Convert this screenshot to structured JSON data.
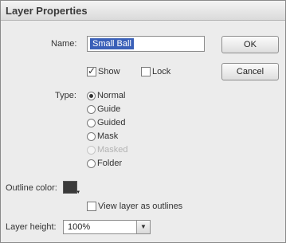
{
  "dialog": {
    "title": "Layer Properties",
    "name_label": "Name:",
    "name_value": "Small Ball",
    "show_label": "Show",
    "show_checked": true,
    "lock_label": "Lock",
    "lock_checked": false,
    "type_label": "Type:",
    "type_options": [
      {
        "label": "Normal",
        "selected": true,
        "enabled": true
      },
      {
        "label": "Guide",
        "selected": false,
        "enabled": true
      },
      {
        "label": "Guided",
        "selected": false,
        "enabled": true
      },
      {
        "label": "Mask",
        "selected": false,
        "enabled": true
      },
      {
        "label": "Masked",
        "selected": false,
        "enabled": false
      },
      {
        "label": "Folder",
        "selected": false,
        "enabled": true
      }
    ],
    "outline_color_label": "Outline color:",
    "outline_color": "#3a3a3a",
    "view_outlines_label": "View layer as outlines",
    "view_outlines_checked": false,
    "layer_height_label": "Layer height:",
    "layer_height_value": "100%",
    "ok_label": "OK",
    "cancel_label": "Cancel"
  }
}
